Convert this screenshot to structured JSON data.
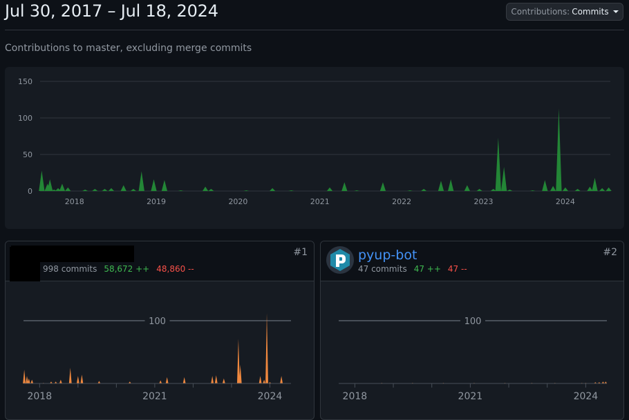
{
  "header": {
    "title": "Jul 30, 2017 – Jul 18, 2024",
    "contributions_prefix": "Contributions:",
    "contributions_value": "Commits"
  },
  "subtitle": "Contributions to master, excluding merge commits",
  "colors": {
    "main": "#238636",
    "contributor": "#f0883e"
  },
  "chart_data": [
    {
      "type": "area",
      "title": "Total commits per week",
      "x_ticks": [
        "2018",
        "2019",
        "2020",
        "2021",
        "2022",
        "2023",
        "2024"
      ],
      "y_ticks": [
        "0",
        "50",
        "100",
        "150"
      ],
      "ylim": [
        0,
        150
      ],
      "xlim": [
        2017.58,
        2024.55
      ],
      "points": [
        [
          2017.6,
          28
        ],
        [
          2017.67,
          10
        ],
        [
          2017.7,
          16
        ],
        [
          2017.75,
          2
        ],
        [
          2017.8,
          4
        ],
        [
          2017.85,
          10
        ],
        [
          2017.92,
          5
        ],
        [
          2018.13,
          2
        ],
        [
          2018.25,
          3
        ],
        [
          2018.37,
          3
        ],
        [
          2018.45,
          4
        ],
        [
          2018.6,
          8
        ],
        [
          2018.72,
          3
        ],
        [
          2018.82,
          27
        ],
        [
          2018.97,
          16
        ],
        [
          2019.1,
          15
        ],
        [
          2019.3,
          1
        ],
        [
          2019.6,
          6
        ],
        [
          2019.67,
          3
        ],
        [
          2020.1,
          1
        ],
        [
          2020.42,
          4
        ],
        [
          2020.65,
          1
        ],
        [
          2021.12,
          5
        ],
        [
          2021.3,
          12
        ],
        [
          2021.45,
          1
        ],
        [
          2021.77,
          12
        ],
        [
          2022.1,
          1
        ],
        [
          2022.27,
          3
        ],
        [
          2022.48,
          14
        ],
        [
          2022.6,
          16
        ],
        [
          2022.8,
          8
        ],
        [
          2022.95,
          3
        ],
        [
          2023.12,
          3
        ],
        [
          2023.18,
          73
        ],
        [
          2023.25,
          33
        ],
        [
          2023.32,
          2
        ],
        [
          2023.6,
          1
        ],
        [
          2023.75,
          15
        ],
        [
          2023.85,
          7
        ],
        [
          2023.92,
          113
        ],
        [
          2024.0,
          5
        ],
        [
          2024.15,
          3
        ],
        [
          2024.3,
          6
        ],
        [
          2024.36,
          18
        ],
        [
          2024.45,
          4
        ],
        [
          2024.53,
          5
        ]
      ]
    },
    {
      "type": "area",
      "title": "#1 contributor",
      "x_ticks": [
        "2018",
        "2021",
        "2024"
      ],
      "y_ticks": [
        "100"
      ],
      "ylim": [
        0,
        100
      ],
      "xlim": [
        2017.58,
        2024.55
      ],
      "points": [
        [
          2017.6,
          22
        ],
        [
          2017.67,
          12
        ],
        [
          2017.72,
          8
        ],
        [
          2017.8,
          6
        ],
        [
          2018.1,
          1
        ],
        [
          2018.3,
          3
        ],
        [
          2018.42,
          3
        ],
        [
          2018.55,
          6
        ],
        [
          2018.8,
          25
        ],
        [
          2019.0,
          12
        ],
        [
          2019.1,
          14
        ],
        [
          2019.55,
          4
        ],
        [
          2020.35,
          3
        ],
        [
          2021.15,
          5
        ],
        [
          2021.32,
          10
        ],
        [
          2021.77,
          10
        ],
        [
          2022.5,
          12
        ],
        [
          2022.6,
          13
        ],
        [
          2022.8,
          8
        ],
        [
          2023.18,
          71
        ],
        [
          2023.23,
          30
        ],
        [
          2023.75,
          12
        ],
        [
          2023.85,
          6
        ],
        [
          2023.92,
          112
        ],
        [
          2024.0,
          2
        ],
        [
          2024.3,
          12
        ]
      ]
    },
    {
      "type": "area",
      "title": "#2 contributor",
      "x_ticks": [
        "2018",
        "2021",
        "2024"
      ],
      "y_ticks": [
        "100"
      ],
      "ylim": [
        0,
        100
      ],
      "xlim": [
        2017.58,
        2024.55
      ],
      "points": [
        [
          2018.7,
          1
        ],
        [
          2019.5,
          1
        ],
        [
          2020.3,
          1
        ],
        [
          2021.1,
          1
        ],
        [
          2021.9,
          1
        ],
        [
          2022.6,
          1
        ],
        [
          2023.2,
          1
        ],
        [
          2023.9,
          1
        ],
        [
          2024.0,
          1
        ],
        [
          2024.25,
          2
        ],
        [
          2024.35,
          2
        ],
        [
          2024.45,
          3
        ],
        [
          2024.52,
          3
        ]
      ]
    }
  ],
  "contributors": [
    {
      "rank": "#1",
      "commits": "998 commits",
      "additions": "58,672 ++",
      "deletions": "48,860 --"
    },
    {
      "rank": "#2",
      "name": "pyup-bot",
      "commits": "47 commits",
      "additions": "47 ++",
      "deletions": "47 --"
    }
  ]
}
